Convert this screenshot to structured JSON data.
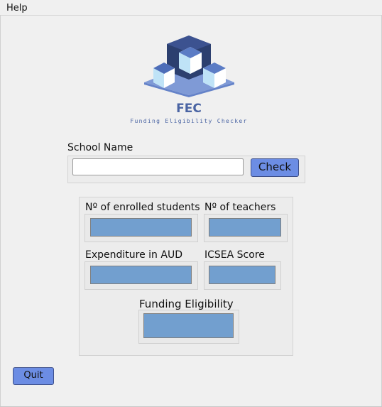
{
  "menu": {
    "help_label": "Help"
  },
  "branding": {
    "title": "FEC",
    "subtitle": "Funding Eligibility Checker",
    "logo_icon": "houses-logo-icon"
  },
  "search": {
    "label": "School Name",
    "value": "",
    "placeholder": "",
    "check_label": "Check"
  },
  "results": {
    "enrolled_label": "Nº of enrolled students",
    "enrolled_value": "",
    "teachers_label": "Nº of teachers",
    "teachers_value": "",
    "expenditure_label": "Expenditure in AUD",
    "expenditure_value": "",
    "icsea_label": "ICSEA Score",
    "icsea_value": "",
    "eligibility_label": "Funding Eligibility",
    "eligibility_value": ""
  },
  "footer": {
    "quit_label": "Quit"
  },
  "colors": {
    "accent": "#6c8de4",
    "value_fill": "#729fcf",
    "brand_text": "#4a64a3",
    "logo_dark": "#2c3f6f",
    "logo_mid": "#5b7cc5",
    "logo_light": "#bfe3f7"
  }
}
